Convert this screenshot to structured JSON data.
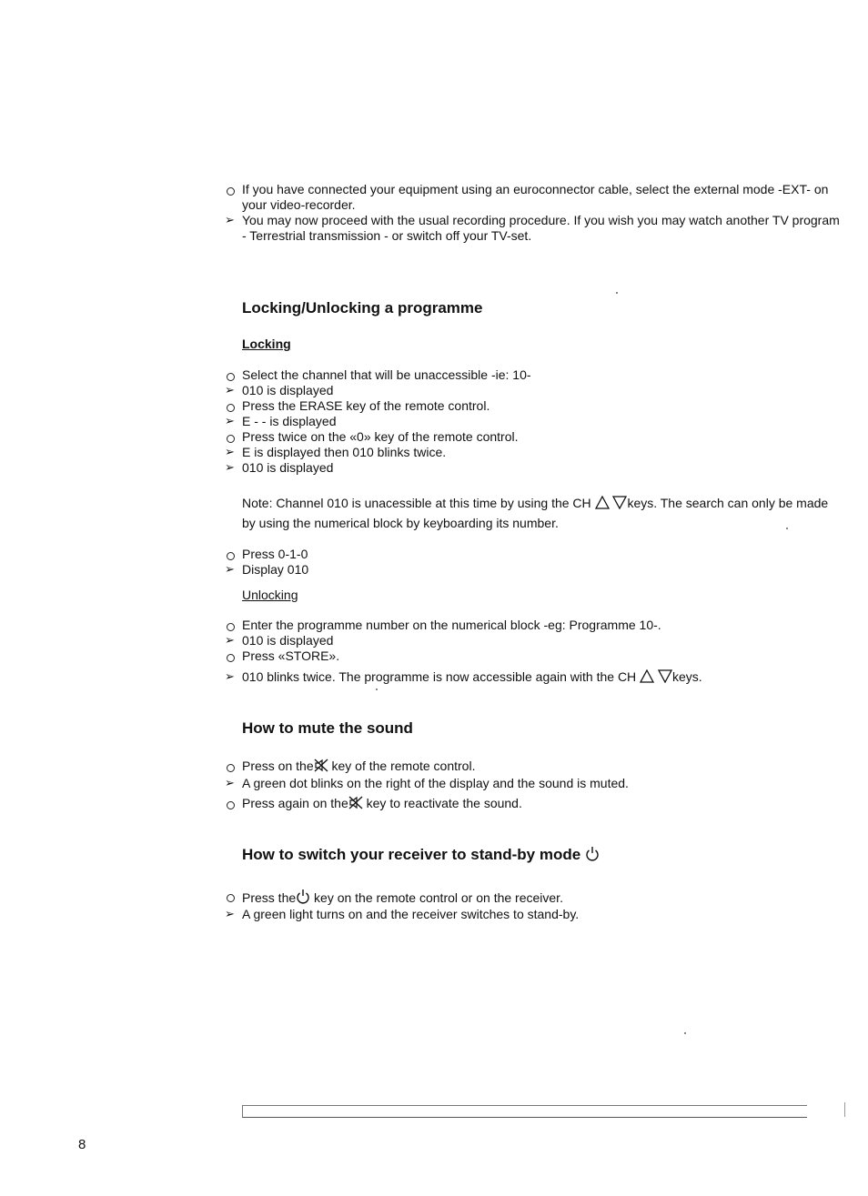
{
  "intro": [
    {
      "bullet": "circle",
      "lines": [
        "If you have connected your equipment using an euroconnector cable, select the external mode -EXT- on",
        "your video-recorder."
      ]
    },
    {
      "bullet": "arrow",
      "lines": [
        "You may now proceed with the usual recording procedure. If you wish you may watch another TV program",
        "- Terrestrial transmission - or switch off your TV-set."
      ]
    }
  ],
  "locking_section": {
    "title": "Locking/Unlocking a programme",
    "locking_label": "Locking",
    "locking_steps": [
      {
        "bullet": "circle",
        "text": "Select the channel that will be unaccessible -ie: 10-"
      },
      {
        "bullet": "arrow",
        "text": "010 is displayed"
      },
      {
        "bullet": "circle",
        "text": "Press the ERASE key of the remote control."
      },
      {
        "bullet": "arrow",
        "text": "E - - is displayed"
      },
      {
        "bullet": "circle",
        "text": "Press twice on the «0» key of the remote control."
      },
      {
        "bullet": "arrow",
        "text": "E is displayed then 010 blinks twice."
      },
      {
        "bullet": "arrow",
        "text": "010 is displayed"
      }
    ],
    "note_part1": "Note: Channel 010 is unacessible at this time by using the CH",
    "note_part2": "keys. The search can only be made",
    "note_line2": "by using the numerical block by keyboarding its number.",
    "press_steps": [
      {
        "bullet": "circle",
        "text": "Press 0-1-0"
      },
      {
        "bullet": "arrow",
        "text": "Display 010"
      }
    ],
    "unlocking_label": "Unlocking",
    "unlocking_steps": [
      {
        "bullet": "circle",
        "text": "Enter the programme number on the numerical block -eg: Programme 10-."
      },
      {
        "bullet": "arrow",
        "text": "010 is displayed"
      },
      {
        "bullet": "circle",
        "text": "Press «STORE»."
      }
    ],
    "final_part1": "010 blinks twice. The programme is now accessible again with the CH",
    "final_part2": "keys."
  },
  "mute_section": {
    "title": "How to mute the sound",
    "step1_a": "Press on the",
    "step1_b": "key of the remote control.",
    "step2": "A green dot blinks on the right of the display and the sound is muted.",
    "step3_a": "Press again on the",
    "step3_b": "key to reactivate the sound."
  },
  "standby_section": {
    "title": "How to switch your receiver to stand-by mode",
    "step1_a": "Press the",
    "step1_b": "key on the remote control or on the receiver.",
    "step2": "A green light turns on and the receiver switches to stand-by."
  },
  "page_number": "8",
  "icons": {
    "up": "triangle-up-outline",
    "down": "triangle-down-outline",
    "mute": "speaker-muted",
    "power": "power-standby"
  }
}
